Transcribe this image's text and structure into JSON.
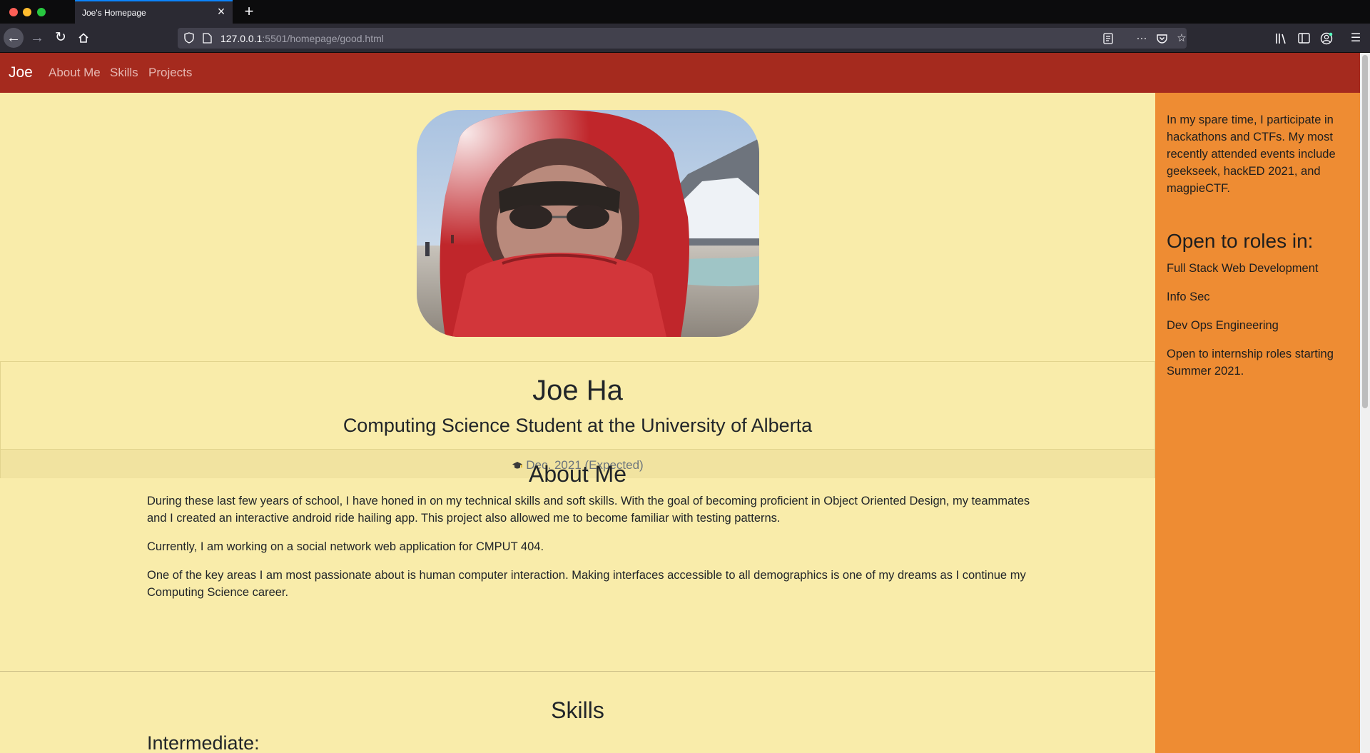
{
  "browser": {
    "tab_title": "Joe's Homepage",
    "url_host": "127.0.0.1",
    "url_path": ":5501/homepage/good.html"
  },
  "site": {
    "brand": "Joe",
    "nav_links": [
      "About Me",
      "Skills",
      "Projects"
    ]
  },
  "header": {
    "name": "Joe Ha",
    "subtitle": "Computing Science Student at the University of Alberta",
    "graduation": "Dec. 2021 (Expected)"
  },
  "about": {
    "title": "About Me",
    "paragraphs": [
      "During these last few years of school, I have honed in on my technical skills and soft skills. With the goal of becoming proficient in Object Oriented Design, my teammates and I created an interactive android ride hailing app. This project also allowed me to become familiar with testing patterns.",
      "Currently, I am working on a social network web application for CMPUT 404.",
      "One of the key areas I am most passionate about is human computer interaction. Making interfaces accessible to all demographics is one of my dreams as I continue my Computing Science career."
    ]
  },
  "skills": {
    "title": "Skills",
    "level": "Intermediate:"
  },
  "sidebar": {
    "intro": "In my spare time, I participate in hackathons and CTFs. My most recently attended events include geekseek, hackED 2021, and magpieCTF.",
    "roles_title": "Open to roles in:",
    "roles": [
      "Full Stack Web Development",
      "Info Sec",
      "Dev Ops Engineering"
    ],
    "internship": "Open to internship roles starting Summer 2021."
  },
  "colors": {
    "navbar": "#a52a1e",
    "main_background": "#f9ecaa",
    "sidebar_background": "#ee8c33"
  }
}
